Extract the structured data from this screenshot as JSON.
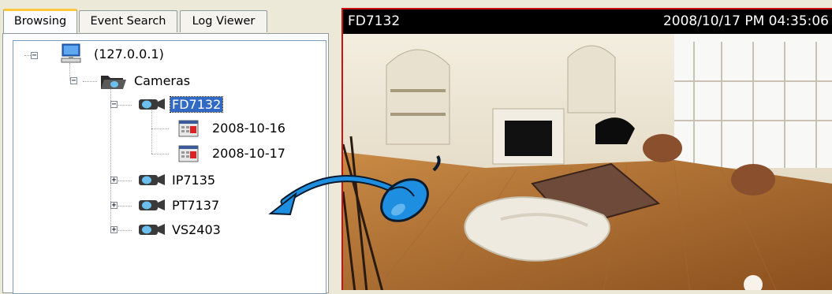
{
  "tabs": [
    {
      "label": "Browsing",
      "active": true
    },
    {
      "label": "Event Search",
      "active": false
    },
    {
      "label": "Log Viewer",
      "active": false
    }
  ],
  "tree": {
    "root": {
      "label": "(127.0.0.1)",
      "icon": "computer-icon"
    },
    "group": {
      "label": "Cameras",
      "icon": "folder-camera-icon"
    },
    "cameras": [
      {
        "label": "FD7132",
        "selected": true,
        "expanded": true,
        "icon": "camera-icon"
      },
      {
        "label": "IP7135",
        "selected": false,
        "expanded": false,
        "icon": "camera-icon"
      },
      {
        "label": "PT7137",
        "selected": false,
        "expanded": false,
        "icon": "camera-icon"
      },
      {
        "label": "VS2403",
        "selected": false,
        "expanded": false,
        "icon": "camera-icon"
      }
    ],
    "dates": [
      {
        "label": "2008-10-16",
        "icon": "calendar-icon"
      },
      {
        "label": "2008-10-17",
        "icon": "calendar-icon"
      }
    ]
  },
  "video": {
    "title": "FD7132",
    "timestamp": "2008/10/17 PM 04:35:06"
  },
  "colors": {
    "selection": "#316ac5",
    "video_border": "#cc1111",
    "mouse": "#1e8fe0",
    "arrow": "#1e8fe0"
  }
}
